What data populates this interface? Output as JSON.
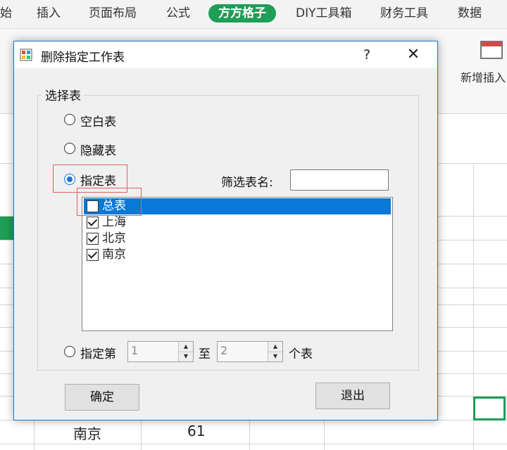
{
  "ribbon": {
    "tabs": [
      {
        "label": "始"
      },
      {
        "label": "插入"
      },
      {
        "label": "页面布局"
      },
      {
        "label": "公式"
      },
      {
        "label": "方方格子"
      },
      {
        "label": "DIY工具箱"
      },
      {
        "label": "财务工具"
      },
      {
        "label": "数据"
      }
    ],
    "active_tab": "方方格子",
    "new_insert_label": "新增插入"
  },
  "sheet": {
    "partial_cells": [
      {
        "text": "南京"
      },
      {
        "text": "61"
      }
    ]
  },
  "dialog": {
    "title": "删除指定工作表",
    "help_label": "?",
    "close_label": "✕",
    "group_label": "选择表",
    "options": {
      "blank": "空白表",
      "hidden": "隐藏表",
      "specified": "指定表",
      "range": "指定第"
    },
    "selected_option": "specified",
    "filter_label": "筛选表名:",
    "filter_value": "",
    "sheets": [
      {
        "name": "总表",
        "checked": false,
        "selected": true
      },
      {
        "name": "上海",
        "checked": true,
        "selected": false
      },
      {
        "name": "北京",
        "checked": true,
        "selected": false
      },
      {
        "name": "南京",
        "checked": true,
        "selected": false
      }
    ],
    "range_from": "1",
    "range_to_label": "至",
    "range_to": "2",
    "range_suffix": "个表",
    "ok_label": "确定",
    "exit_label": "退出"
  },
  "colors": {
    "accent_green": "#1e9e57",
    "selection_blue": "#0a78d7",
    "dialog_border": "#1979ca",
    "highlight_red": "#e06060"
  }
}
